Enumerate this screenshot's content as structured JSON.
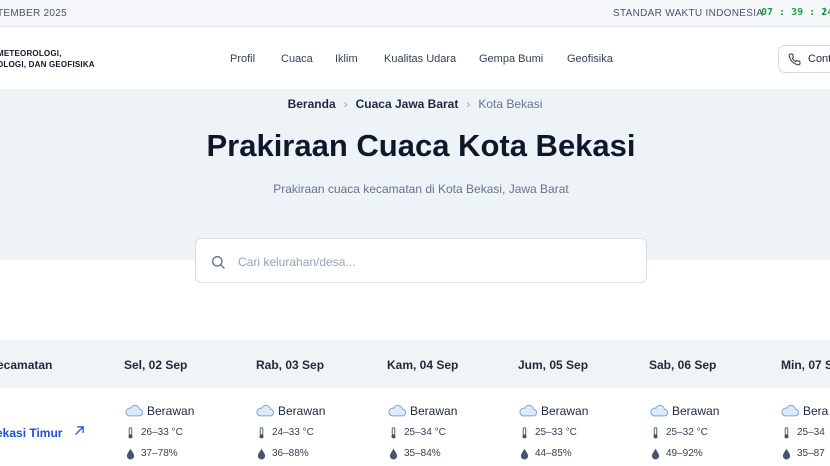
{
  "topbar": {
    "date_fragment": "TEMBER 2025",
    "timezone_label": "STANDAR WAKTU INDONESIA",
    "clock": "07 : 39 : 24",
    "separator": "/"
  },
  "header": {
    "brand_line1": "METEOROLOGI,",
    "brand_line2": "OLOGI, DAN GEOFISIKA",
    "nav": [
      "Profil",
      "Cuaca",
      "Iklim",
      "Kualitas Udara",
      "Gempa Bumi",
      "Geofisika"
    ],
    "contact_label": "Cont",
    "contact_icon": "phone-icon"
  },
  "hero": {
    "breadcrumb": [
      "Beranda",
      "Cuaca Jawa Barat",
      "Kota Bekasi"
    ],
    "title": "Prakiraan Cuaca Kota Bekasi",
    "subtitle": "Prakiraan cuaca kecamatan di Kota Bekasi, Jawa Barat"
  },
  "search": {
    "placeholder": "Cari kelurahan/desa...",
    "value": "",
    "icon": "search-icon"
  },
  "table": {
    "header_kecamatan": "ecamatan",
    "days": [
      "Sel, 02 Sep",
      "Rab, 03 Sep",
      "Kam, 04 Sep",
      "Jum, 05 Sep",
      "Sab, 06 Sep",
      "Min, 07 S"
    ],
    "rows": [
      {
        "kecamatan": "ekasi Timur",
        "cells": [
          {
            "condition": "Berawan",
            "temp": "26–33 °C",
            "humidity": "37–78%"
          },
          {
            "condition": "Berawan",
            "temp": "24–33 °C",
            "humidity": "36–88%"
          },
          {
            "condition": "Berawan",
            "temp": "25–34 °C",
            "humidity": "35–84%"
          },
          {
            "condition": "Berawan",
            "temp": "25–33 °C",
            "humidity": "44–85%"
          },
          {
            "condition": "Berawan",
            "temp": "25–32 °C",
            "humidity": "49–92%"
          },
          {
            "condition": "Bera",
            "temp": "25–34",
            "humidity": "35–87"
          }
        ]
      }
    ]
  },
  "colors": {
    "clock_green": "#16a34a",
    "link_blue": "#1d4ed8",
    "hero_bg": "#eef3f8"
  }
}
